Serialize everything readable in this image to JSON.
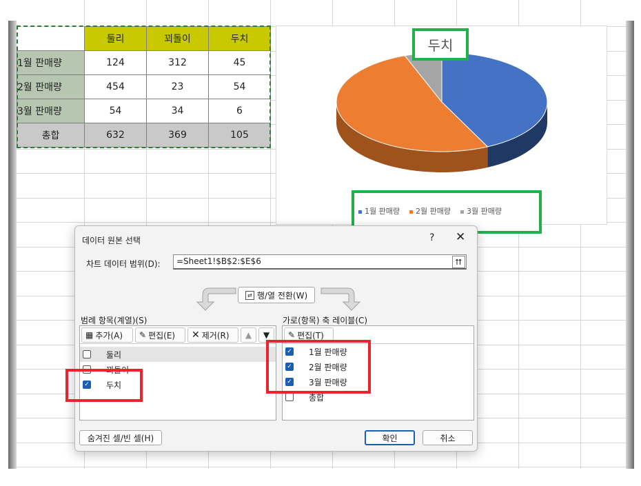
{
  "table": {
    "headers": [
      "",
      "둘리",
      "꾀돌이",
      "두치"
    ],
    "rows": [
      [
        "1월 판매량",
        "124",
        "312",
        "45"
      ],
      [
        "2월 판매량",
        "454",
        "23",
        "54"
      ],
      [
        "3월 판매량",
        "54",
        "34",
        "6"
      ],
      [
        "총합",
        "632",
        "369",
        "105"
      ]
    ]
  },
  "chart_data": {
    "type": "pie",
    "title": "두치",
    "categories": [
      "1월 판매량",
      "2월 판매량",
      "3월 판매량"
    ],
    "values": [
      45,
      54,
      6
    ],
    "colors": [
      "#4472c4",
      "#ed7d31",
      "#a5a5a5"
    ],
    "legend_position": "bottom"
  },
  "dialog": {
    "title": "데이터 원본 선택",
    "help": "?",
    "close": "✕",
    "range_label": "차트 데이터 범위(D):",
    "range_value": "=Sheet1!$B$2:$E$6",
    "range_button": "⮅",
    "switch_label": "행/열 전환(W)",
    "series_label": "범례 항목(계열)(S)",
    "axis_label": "가로(항목) 축 레이블(C)",
    "add_label": "추가(A)",
    "edit_label": "편집(E)",
    "remove_label": "제거(R)",
    "axis_edit_label": "편집(T)",
    "series": [
      {
        "name": "둘리",
        "checked": false
      },
      {
        "name": "꾀돌이",
        "checked": false
      },
      {
        "name": "두치",
        "checked": true
      }
    ],
    "axis_items": [
      {
        "name": "1월 판매량",
        "checked": true
      },
      {
        "name": "2월 판매량",
        "checked": true
      },
      {
        "name": "3월 판매량",
        "checked": true
      },
      {
        "name": "총합",
        "checked": false
      }
    ],
    "hidden_cells_label": "숨겨진 셀/빈 셀(H)",
    "ok_label": "확인",
    "cancel_label": "취소"
  }
}
